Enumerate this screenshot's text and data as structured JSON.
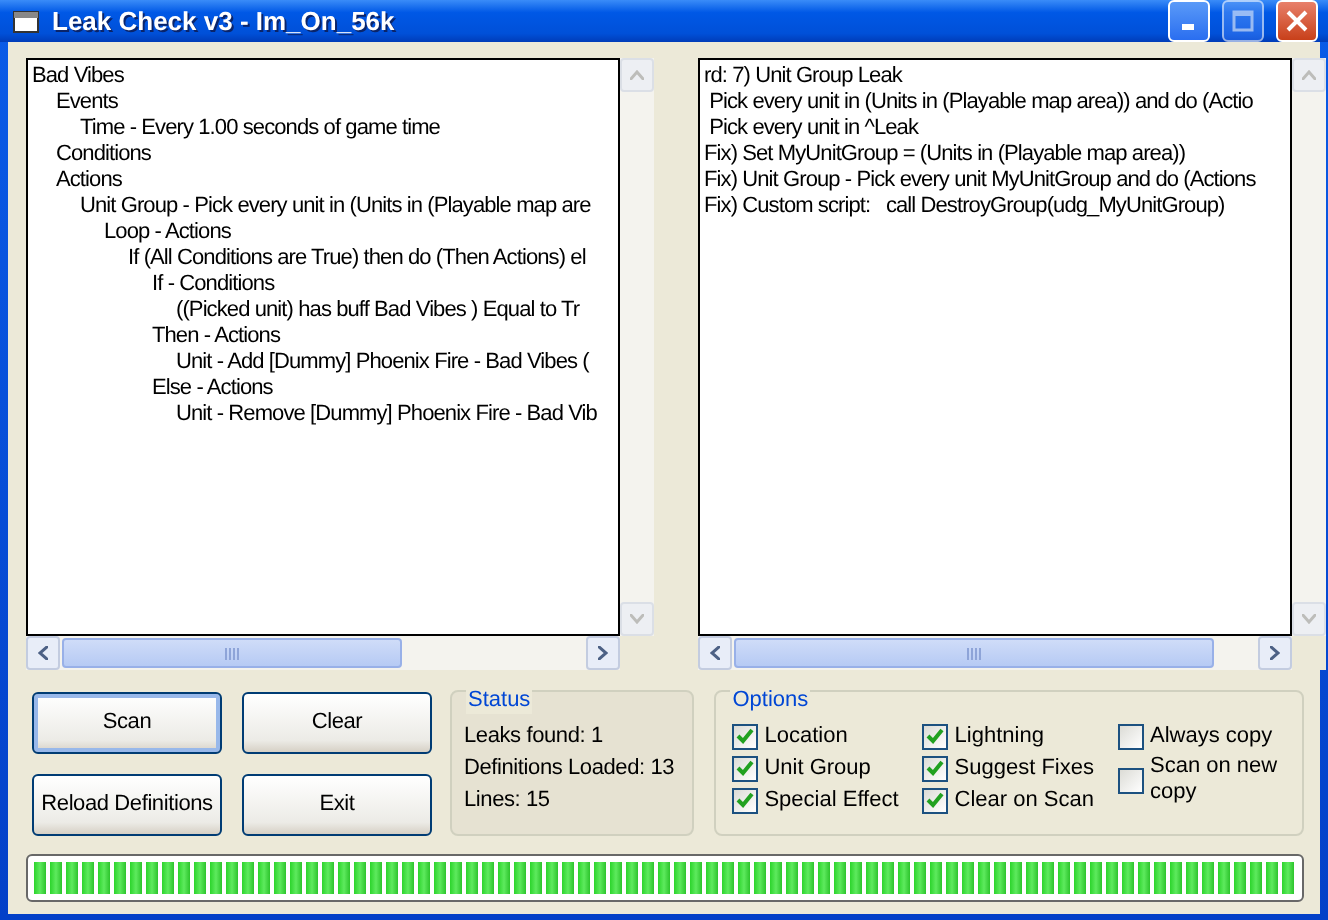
{
  "window": {
    "title": "Leak Check v3 - Im_On_56k"
  },
  "trigger_pane": {
    "lines": [
      {
        "text": "Bad Vibes",
        "children": [
          {
            "text": "Events",
            "children": [
              {
                "text": "Time - Every 1.00 seconds of game time"
              }
            ]
          },
          {
            "text": "Conditions"
          },
          {
            "text": "Actions",
            "children": [
              {
                "text": "Unit Group - Pick every unit in (Units in (Playable map are",
                "children": [
                  {
                    "text": "Loop - Actions",
                    "children": [
                      {
                        "text": "If (All Conditions are True) then do (Then Actions) el",
                        "children": [
                          {
                            "text": "If - Conditions",
                            "children": [
                              {
                                "text": "((Picked unit) has buff Bad Vibes ) Equal to Tr"
                              }
                            ]
                          },
                          {
                            "text": "Then - Actions",
                            "children": [
                              {
                                "text": "Unit - Add [Dummy] Phoenix Fire - Bad Vibes ("
                              }
                            ]
                          },
                          {
                            "text": "Else - Actions",
                            "children": [
                              {
                                "text": "Unit - Remove [Dummy] Phoenix Fire - Bad Vib"
                              }
                            ]
                          }
                        ]
                      }
                    ]
                  }
                ]
              }
            ]
          }
        ]
      }
    ]
  },
  "result_pane": {
    "lines": [
      "rd: 7) Unit Group Leak",
      " Pick every unit in (Units in (Playable map area)) and do (Actio",
      " Pick every unit in ^Leak",
      "Fix) Set MyUnitGroup = (Units in (Playable map area))",
      "Fix) Unit Group - Pick every unit MyUnitGroup and do (Actions",
      "Fix) Custom script:   call DestroyGroup(udg_MyUnitGroup)"
    ]
  },
  "buttons": [
    {
      "label": "Scan",
      "default": true
    },
    {
      "label": "Clear",
      "default": false
    },
    {
      "label": "Reload Definitions",
      "default": false
    },
    {
      "label": "Exit",
      "default": false
    }
  ],
  "status": {
    "title": "Status",
    "lines": [
      "Leaks found: 1",
      "Definitions Loaded: 13",
      "Lines: 15"
    ]
  },
  "options": {
    "title": "Options",
    "columns": [
      [
        {
          "label": "Location",
          "checked": true
        },
        {
          "label": "Unit Group",
          "checked": true
        },
        {
          "label": "Special Effect",
          "checked": true
        }
      ],
      [
        {
          "label": "Lightning",
          "checked": true
        },
        {
          "label": "Suggest Fixes",
          "checked": true
        },
        {
          "label": "Clear on Scan",
          "checked": true
        }
      ],
      [
        {
          "label": "Always copy",
          "checked": false
        },
        {
          "label": "Scan on new copy",
          "checked": false
        }
      ]
    ]
  },
  "progress": {
    "level": 1
  }
}
